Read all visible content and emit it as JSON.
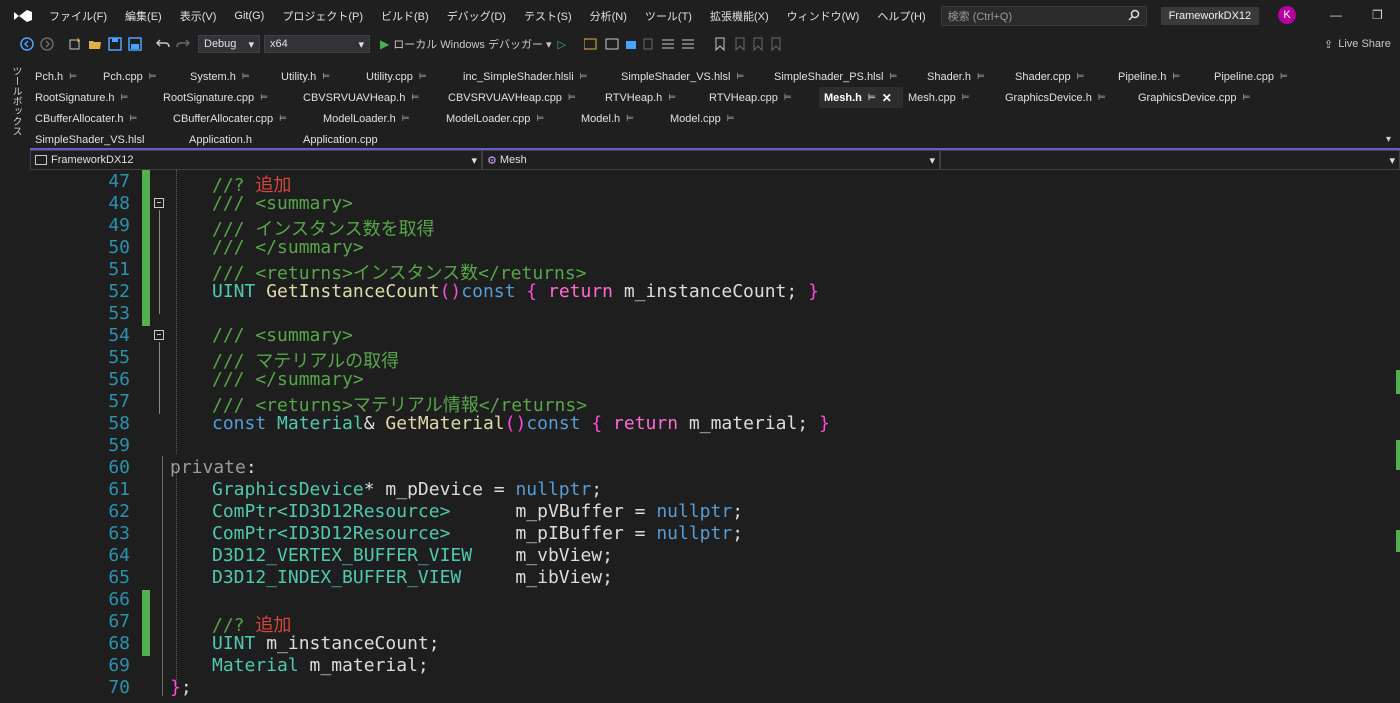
{
  "menubar": {
    "items": [
      "ファイル(F)",
      "編集(E)",
      "表示(V)",
      "Git(G)",
      "プロジェクト(P)",
      "ビルド(B)",
      "デバッグ(D)",
      "テスト(S)",
      "分析(N)",
      "ツール(T)",
      "拡張機能(X)",
      "ウィンドウ(W)",
      "ヘルプ(H)"
    ],
    "search_placeholder": "検索 (Ctrl+Q)",
    "solution_name": "FrameworkDX12",
    "avatar_letter": "K",
    "minimize_glyph": "—",
    "restore_glyph": "❐"
  },
  "toolbar": {
    "config": "Debug",
    "platform": "x64",
    "run_label": "ローカル Windows デバッガー",
    "live_share": "Live Share"
  },
  "side_label": "ツールボックス",
  "tab_rows": [
    [
      "Pch.h",
      "Pch.cpp",
      "System.h",
      "Utility.h",
      "Utility.cpp",
      "inc_SimpleShader.hlsli",
      "SimpleShader_VS.hlsl",
      "SimpleShader_PS.hlsl",
      "Shader.h",
      "Shader.cpp",
      "Pipeline.h",
      "Pipeline.cpp"
    ],
    [
      "RootSignature.h",
      "RootSignature.cpp",
      "CBVSRVUAVHeap.h",
      "CBVSRVUAVHeap.cpp",
      "RTVHeap.h",
      "RTVHeap.cpp",
      "Mesh.h",
      "Mesh.cpp",
      "GraphicsDevice.h",
      "GraphicsDevice.cpp"
    ],
    [
      "CBufferAllocater.h",
      "CBufferAllocater.cpp",
      "ModelLoader.h",
      "ModelLoader.cpp",
      "Model.h",
      "Model.cpp"
    ],
    [
      "SimpleShader_VS.hlsl",
      "Application.h",
      "Application.cpp"
    ]
  ],
  "active_tab": "Mesh.h",
  "nav": {
    "project": "FrameworkDX12",
    "scope": "Mesh",
    "member": ""
  },
  "line_numbers": [
    "47",
    "48",
    "49",
    "50",
    "51",
    "52",
    "53",
    "54",
    "55",
    "56",
    "57",
    "58",
    "59",
    "60",
    "61",
    "62",
    "63",
    "64",
    "65",
    "66",
    "67",
    "68",
    "69",
    "70"
  ],
  "code": {
    "l47_cm": "//? ",
    "l47_red": "追加",
    "l48": "/// <summary>",
    "l49": "/// インスタンス数を取得",
    "l50": "/// </summary>",
    "l51": "/// <returns>インスタンス数</returns>",
    "l52_t": "UINT ",
    "l52_f": "GetInstanceCount",
    "l52_p": "()",
    "l52_k": "const ",
    "l52_b1": "{ ",
    "l52_r": "return ",
    "l52_id": "m_instanceCount; ",
    "l52_b2": "}",
    "l54": "/// <summary>",
    "l55": "/// マテリアルの取得",
    "l56": "/// </summary>",
    "l57": "/// <returns>マテリアル情報</returns>",
    "l58_k": "const ",
    "l58_t": "Material",
    "l58_a": "& ",
    "l58_f": "GetMaterial",
    "l58_p": "()",
    "l58_k2": "const ",
    "l58_b1": "{ ",
    "l58_r": "return ",
    "l58_id": "m_material; ",
    "l58_b2": "}",
    "l60_k": "private",
    "l60_c": ":",
    "l61_t": "GraphicsDevice",
    "l61_id": "* m_pDevice = ",
    "l61_k": "nullptr",
    "l61_s": ";",
    "l62_t": "ComPtr<ID3D12Resource>",
    "l62_id": "      m_pVBuffer = ",
    "l62_k": "nullptr",
    "l62_s": ";",
    "l63_t": "ComPtr<ID3D12Resource>",
    "l63_id": "      m_pIBuffer = ",
    "l63_k": "nullptr",
    "l63_s": ";",
    "l64_t": "D3D12_VERTEX_BUFFER_VIEW",
    "l64_id": "    m_vbView;",
    "l65_t": "D3D12_INDEX_BUFFER_VIEW",
    "l65_id": "     m_ibView;",
    "l67_cm": "//? ",
    "l67_red": "追加",
    "l68_t": "UINT ",
    "l68_id": "m_instanceCount;",
    "l69_t": "Material ",
    "l69_id": "m_material;",
    "l70_b": "}",
    "l70_s": ";"
  },
  "colors": {
    "keyword": "#569cd6",
    "type": "#4ec9b0",
    "function": "#dcdcaa",
    "comment": "#57a64a",
    "line_number": "#2b91af",
    "change_bar": "#53b04f",
    "brace": "#ff4ae1"
  }
}
